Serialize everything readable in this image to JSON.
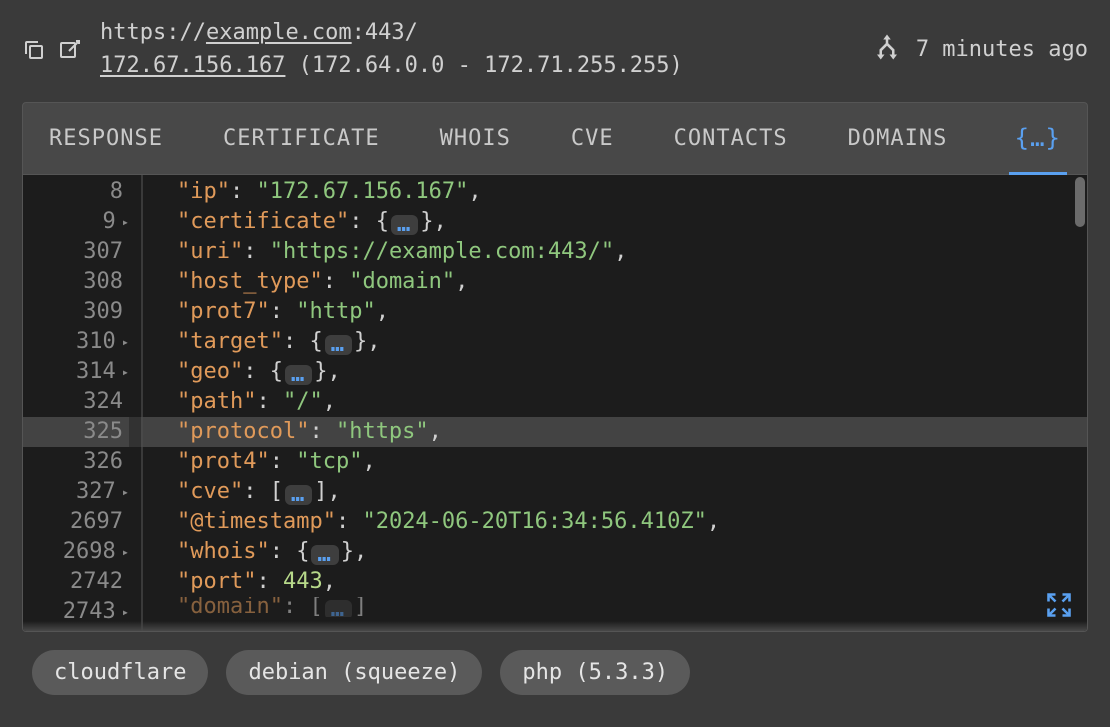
{
  "header": {
    "url_prefix": "https://",
    "url_host": "example.com",
    "url_suffix": ":443/",
    "ip": "172.67.156.167",
    "ip_range": " (172.64.0.0 - 172.71.255.255)",
    "time_ago": "7 minutes ago"
  },
  "tabs": {
    "response": "RESPONSE",
    "certificate": "CERTIFICATE",
    "whois": "WHOIS",
    "cve": "CVE",
    "contacts": "CONTACTS",
    "domains": "DOMAINS",
    "json": "{…}"
  },
  "code_lines": [
    {
      "num": "8",
      "fold": false,
      "key": "ip",
      "type": "str",
      "val": "172.67.156.167",
      "comma": true
    },
    {
      "num": "9",
      "fold": true,
      "key": "certificate",
      "type": "obj",
      "comma": true
    },
    {
      "num": "307",
      "fold": false,
      "key": "uri",
      "type": "str",
      "val": "https://example.com:443/",
      "comma": true
    },
    {
      "num": "308",
      "fold": false,
      "key": "host_type",
      "type": "str",
      "val": "domain",
      "comma": true
    },
    {
      "num": "309",
      "fold": false,
      "key": "prot7",
      "type": "str",
      "val": "http",
      "comma": true
    },
    {
      "num": "310",
      "fold": true,
      "key": "target",
      "type": "obj",
      "comma": true
    },
    {
      "num": "314",
      "fold": true,
      "key": "geo",
      "type": "obj",
      "comma": true
    },
    {
      "num": "324",
      "fold": false,
      "key": "path",
      "type": "str",
      "val": "/",
      "comma": true
    },
    {
      "num": "325",
      "fold": false,
      "key": "protocol",
      "type": "str",
      "val": "https",
      "comma": true,
      "highlight": true
    },
    {
      "num": "326",
      "fold": false,
      "key": "prot4",
      "type": "str",
      "val": "tcp",
      "comma": true
    },
    {
      "num": "327",
      "fold": true,
      "key": "cve",
      "type": "arr",
      "comma": true
    },
    {
      "num": "2697",
      "fold": false,
      "key": "@timestamp",
      "type": "str",
      "val": "2024-06-20T16:34:56.410Z",
      "comma": true
    },
    {
      "num": "2698",
      "fold": true,
      "key": "whois",
      "type": "obj",
      "comma": true
    },
    {
      "num": "2742",
      "fold": false,
      "key": "port",
      "type": "num",
      "val": "443",
      "comma": true
    },
    {
      "num": "2743",
      "fold": true,
      "key": "domain",
      "type": "arr",
      "comma": false,
      "truncated": true
    }
  ],
  "fold_dots": "…",
  "chips": [
    "cloudflare",
    "debian (squeeze)",
    "php (5.3.3)"
  ]
}
